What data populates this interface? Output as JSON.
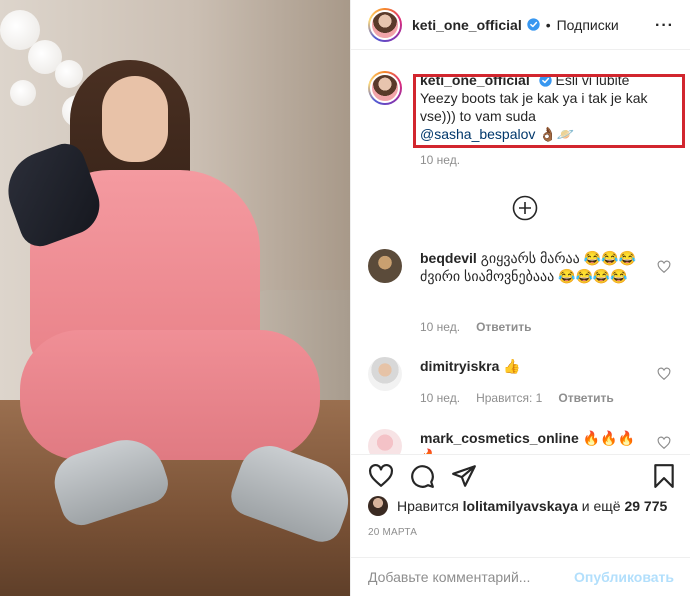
{
  "post": {
    "author": "keti_one_official",
    "separator": "•",
    "follow_state": "Подписки",
    "more_icon": "more-horizontal-icon"
  },
  "caption": {
    "username": "keti_one_official",
    "text": "Esli vi lubite Yeezy boots tak je kak ya i tak je kak vse))) to vam suda",
    "mention": "@sasha_bespalov",
    "emoji": "👌🏾🪐",
    "time": "10 нед."
  },
  "load_more_icon": "plus-circle-icon",
  "comments": [
    {
      "username": "beqdevil",
      "text": "გიყვარს მარაა 😂😂😂ძვირი სიამოვნებააა 😂😂😂😂",
      "time": "10 нед.",
      "likes": "",
      "reply_label": "Ответить"
    },
    {
      "username": "dimitryiskra",
      "text": "👍",
      "time": "10 нед.",
      "likes": "Нравится: 1",
      "reply_label": "Ответить"
    },
    {
      "username": "mark_cosmetics_online",
      "text": "🔥🔥🔥🔥",
      "time": "",
      "likes": "",
      "reply_label": ""
    }
  ],
  "likes": {
    "prefix": "Нравится",
    "user": "lolitamilyavskaya",
    "middle": "и ещё",
    "count": "29 775"
  },
  "date": "20 МАРТА",
  "add_comment": {
    "placeholder": "Добавьте комментарий...",
    "post_label": "Опубликовать"
  },
  "colors": {
    "verified": "#3897f0",
    "highlight_box": "#d2262e",
    "post_button_disabled": "#b2dffc",
    "link": "#00376b"
  }
}
